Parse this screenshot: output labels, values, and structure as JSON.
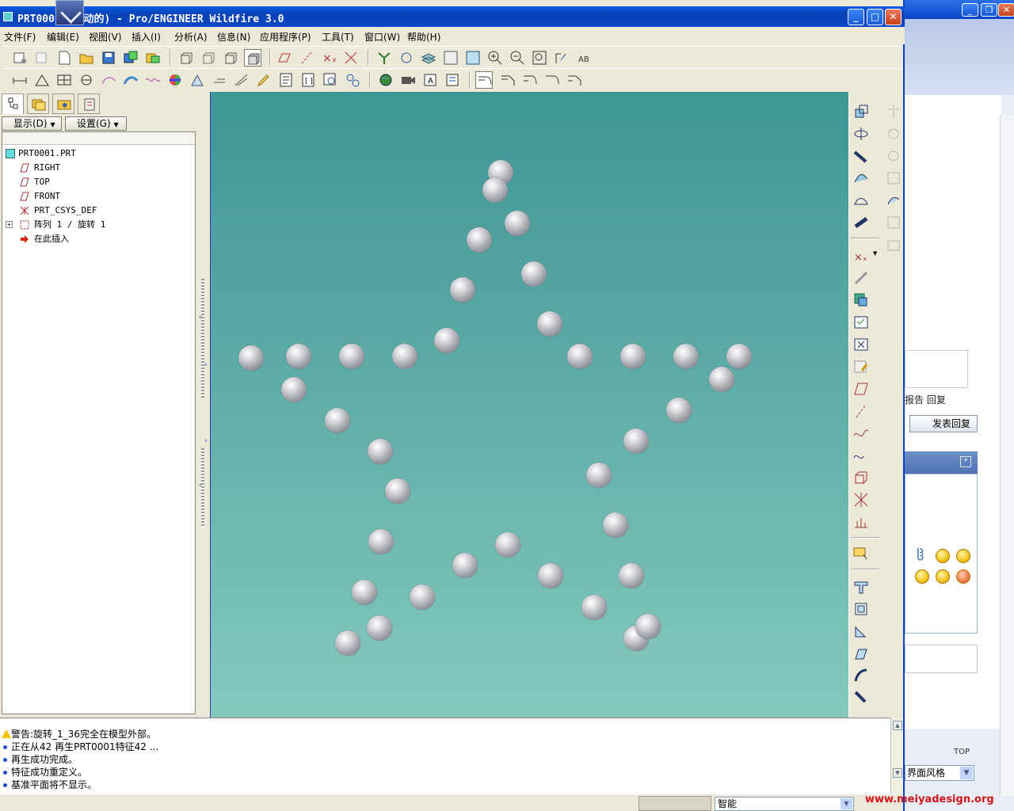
{
  "window": {
    "title": "PRT0001 (活动的) - Pro/ENGINEER Wildfire 3.0",
    "min_label": "_",
    "max_label": "□",
    "close_label": "✕"
  },
  "menu": [
    "文件(F)",
    "编辑(E)",
    "视图(V)",
    "插入(I)",
    "分析(A)",
    "信息(N)",
    "应用程序(P)",
    "工具(T)",
    "窗口(W)",
    "帮助(H)"
  ],
  "navigator": {
    "show_button": "显示(D)",
    "settings_button": "设置(G)",
    "tree": [
      {
        "label": "PRT0001.PRT",
        "icon": "part-icon"
      },
      {
        "label": "RIGHT",
        "icon": "datum-plane-icon"
      },
      {
        "label": "TOP",
        "icon": "datum-plane-icon"
      },
      {
        "label": "FRONT",
        "icon": "datum-plane-icon"
      },
      {
        "label": "PRT_CSYS_DEF",
        "icon": "coordinate-system-icon"
      },
      {
        "label": "阵列 1 / 旋转 1",
        "icon": "pattern-icon"
      },
      {
        "label": "在此插入",
        "icon": "insert-here-arrow-icon"
      }
    ]
  },
  "messages": [
    {
      "text": "警告:旋转_1_36完全在模型外部。",
      "type": "warning"
    },
    {
      "text": "正在从42 再生PRT0001特征42 ...",
      "type": "info"
    },
    {
      "text": "再生成功完成。",
      "type": "info"
    },
    {
      "text": "特征成功重定义。",
      "type": "info"
    },
    {
      "text": "基准平面将不显示。",
      "type": "info"
    }
  ],
  "status": {
    "filter_value": "智能"
  },
  "background_window": {
    "reply_label": "报告  回复",
    "post_reply_button": "发表回复",
    "view_label": "TOP",
    "style_select": "界面风格"
  },
  "watermark": "www.meiyadesign.org",
  "colors": {
    "title_bar": "#0a46c8",
    "viewport_top": "#3e9696",
    "viewport_bottom": "#85c9bd",
    "watermark": "#d4121a"
  }
}
